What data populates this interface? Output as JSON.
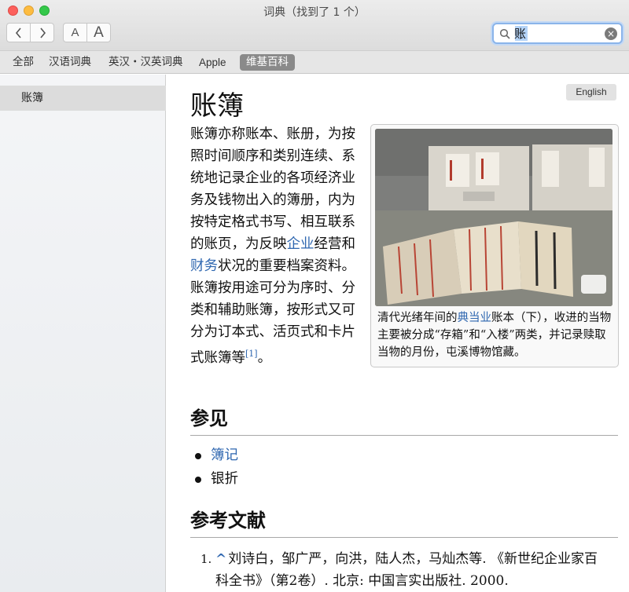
{
  "window": {
    "title": "词典（找到了 1 个）"
  },
  "toolbar": {
    "back_icon": "chevron-left-icon",
    "forward_icon": "chevron-right-icon",
    "font_smaller_label": "A",
    "font_larger_label": "A",
    "search_value": "账"
  },
  "sources": [
    {
      "label": "全部",
      "active": false
    },
    {
      "label": "汉语词典",
      "active": false
    },
    {
      "label": "英汉・汉英词典",
      "active": false
    },
    {
      "label": "Apple",
      "active": false
    },
    {
      "label": "维基百科",
      "active": true
    }
  ],
  "sidebar": {
    "items": [
      {
        "label": "账簿",
        "selected": true
      }
    ]
  },
  "article": {
    "language_badge": "English",
    "title": "账簿",
    "lead_1": "账簿亦称账本、账册，为按照时间顺序和类别连续、系统地记录企业的各项经济业务及钱物出入的簿册，内为按特定格式书写、相互联系的账页，为反映",
    "lead_link_1": "企业",
    "lead_2": "经营和",
    "lead_link_2": "财务",
    "lead_3": "状况的重要档案资料。账簿按用途可分为序时、分类和辅助账簿，按形式又可分为订本式、活页式和卡片式账簿等",
    "lead_ref": "[1]",
    "lead_end": "。",
    "figure": {
      "caption_1": "清代光绪年间的",
      "caption_link": "典当业",
      "caption_2": "账本（下），收进的当物主要被分成“存箱”和“入楼”两类，并记录赎取当物的月份，屯溪博物馆藏。"
    },
    "see_also_heading": "参见",
    "see_also": [
      {
        "label": "簿记",
        "link": true
      },
      {
        "label": "银折",
        "link": false
      }
    ],
    "references_heading": "参考文献",
    "references": [
      {
        "num": "1.",
        "caret": "^",
        "text": "刘诗白，邹广严，向洪，陆人杰，马灿杰等. 《新世纪企业家百科全书》（第2卷）. 北京: 中国言实出版社. 2000."
      }
    ]
  },
  "colors": {
    "link": "#2f67b0",
    "active_tab": "#8a8a8a",
    "search_focus": "#8ab4ea"
  }
}
